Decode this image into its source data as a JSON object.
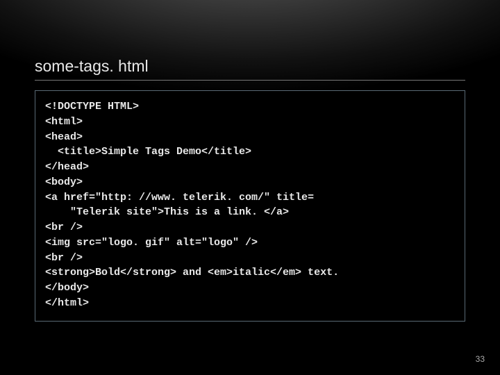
{
  "title": "some-tags. html",
  "code_lines": [
    "<!DOCTYPE HTML>",
    "<html>",
    "<head>",
    "  <title>Simple Tags Demo</title>",
    "</head>",
    "<body>",
    "<a href=\"http: //www. telerik. com/\" title=",
    "    \"Telerik site\">This is a link. </a>",
    "<br />",
    "<img src=\"logo. gif\" alt=\"logo\" />",
    "<br />",
    "<strong>Bold</strong> and <em>italic</em> text.",
    "</body>",
    "</html>"
  ],
  "slide_number": "33"
}
